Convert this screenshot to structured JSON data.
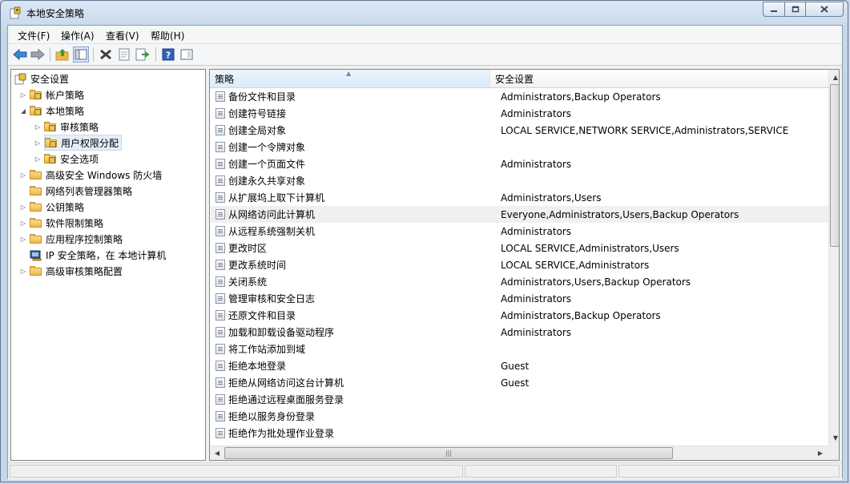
{
  "window": {
    "title": "本地安全策略"
  },
  "menu": [
    "文件(F)",
    "操作(A)",
    "查看(V)",
    "帮助(H)"
  ],
  "toolbar": [
    "back-icon",
    "forward-icon",
    "up-icon",
    "show-hide-tree-icon",
    "delete-icon",
    "properties-icon",
    "export-icon",
    "help-icon",
    "view-icon"
  ],
  "tree": [
    {
      "label": "安全设置",
      "level": 0,
      "expand": "none",
      "icon": "security-settings-icon"
    },
    {
      "label": "帐户策略",
      "level": 1,
      "expand": "collapsed",
      "icon": "lock-folder-icon"
    },
    {
      "label": "本地策略",
      "level": 1,
      "expand": "expanded",
      "icon": "lock-folder-icon"
    },
    {
      "label": "审核策略",
      "level": 2,
      "expand": "collapsed",
      "icon": "lock-folder-icon"
    },
    {
      "label": "用户权限分配",
      "level": 2,
      "expand": "collapsed",
      "icon": "lock-folder-icon",
      "selected": true
    },
    {
      "label": "安全选项",
      "level": 2,
      "expand": "collapsed",
      "icon": "lock-folder-icon"
    },
    {
      "label": "高级安全 Windows 防火墙",
      "level": 1,
      "expand": "collapsed",
      "icon": "folder-icon"
    },
    {
      "label": "网络列表管理器策略",
      "level": 1,
      "expand": "none",
      "icon": "folder-icon"
    },
    {
      "label": "公钥策略",
      "level": 1,
      "expand": "collapsed",
      "icon": "folder-icon"
    },
    {
      "label": "软件限制策略",
      "level": 1,
      "expand": "collapsed",
      "icon": "folder-icon"
    },
    {
      "label": "应用程序控制策略",
      "level": 1,
      "expand": "collapsed",
      "icon": "folder-icon"
    },
    {
      "label": "IP 安全策略，在 本地计算机",
      "level": 1,
      "expand": "none",
      "icon": "ip-security-icon"
    },
    {
      "label": "高级审核策略配置",
      "level": 1,
      "expand": "collapsed",
      "icon": "folder-icon"
    }
  ],
  "columns": {
    "policy": "策略",
    "setting": "安全设置"
  },
  "rows": [
    {
      "policy": "备份文件和目录",
      "setting": "Administrators,Backup Operators"
    },
    {
      "policy": "创建符号链接",
      "setting": "Administrators"
    },
    {
      "policy": "创建全局对象",
      "setting": "LOCAL SERVICE,NETWORK SERVICE,Administrators,SERVICE"
    },
    {
      "policy": "创建一个令牌对象",
      "setting": ""
    },
    {
      "policy": "创建一个页面文件",
      "setting": "Administrators"
    },
    {
      "policy": "创建永久共享对象",
      "setting": ""
    },
    {
      "policy": "从扩展坞上取下计算机",
      "setting": "Administrators,Users"
    },
    {
      "policy": "从网络访问此计算机",
      "setting": "Everyone,Administrators,Users,Backup Operators",
      "highlighted": true
    },
    {
      "policy": "从远程系统强制关机",
      "setting": "Administrators"
    },
    {
      "policy": "更改时区",
      "setting": "LOCAL SERVICE,Administrators,Users"
    },
    {
      "policy": "更改系统时间",
      "setting": "LOCAL SERVICE,Administrators"
    },
    {
      "policy": "关闭系统",
      "setting": "Administrators,Users,Backup Operators"
    },
    {
      "policy": "管理审核和安全日志",
      "setting": "Administrators"
    },
    {
      "policy": "还原文件和目录",
      "setting": "Administrators,Backup Operators"
    },
    {
      "policy": "加载和卸载设备驱动程序",
      "setting": "Administrators"
    },
    {
      "policy": "将工作站添加到域",
      "setting": ""
    },
    {
      "policy": "拒绝本地登录",
      "setting": "Guest"
    },
    {
      "policy": "拒绝从网络访问这台计算机",
      "setting": "Guest"
    },
    {
      "policy": "拒绝通过远程桌面服务登录",
      "setting": ""
    },
    {
      "policy": "拒绝以服务身份登录",
      "setting": ""
    },
    {
      "policy": "拒绝作为批处理作业登录",
      "setting": ""
    }
  ],
  "colors": {
    "selection": "#e5eef8",
    "hover_row": "#f0f0f0",
    "header_sorted": "#d9ebfa"
  }
}
